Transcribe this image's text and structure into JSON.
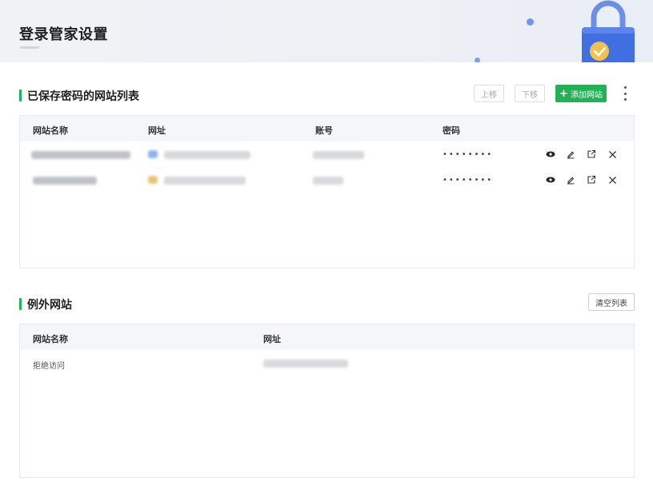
{
  "header": {
    "title": "登录管家设置"
  },
  "saved": {
    "title": "已保存密码的网站列表",
    "buttons": {
      "move_up": "上移",
      "move_down": "下移",
      "add": "添加网站"
    },
    "columns": {
      "name": "网站名称",
      "url": "网址",
      "account": "账号",
      "password": "密码"
    },
    "rows": [
      {
        "password": "••••••••"
      },
      {
        "password": "••••••••"
      }
    ],
    "icons": [
      "eye-icon",
      "edit-icon",
      "open-external-icon",
      "close-icon"
    ]
  },
  "exceptions": {
    "title": "例外网站",
    "clear_button": "清空列表",
    "columns": {
      "name": "网站名称",
      "url": "网址"
    },
    "rows": [
      {
        "name": "拒绝访问"
      }
    ]
  },
  "colors": {
    "accent": "#22b255",
    "lock": "#3f6fe0"
  }
}
